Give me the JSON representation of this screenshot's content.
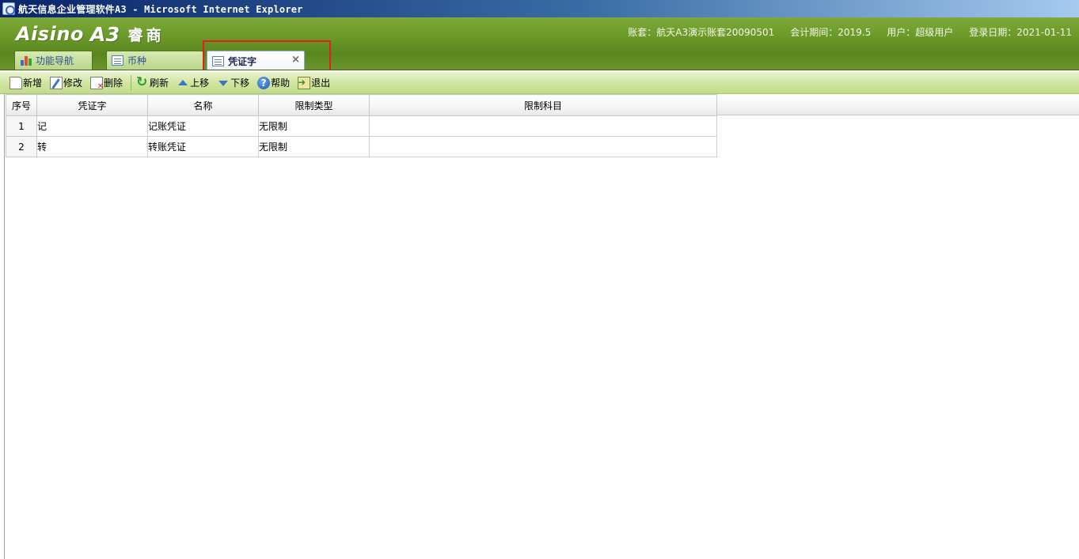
{
  "window": {
    "title": "航天信息企业管理软件A3 - Microsoft Internet Explorer"
  },
  "brand": {
    "logo_text": "Aisino",
    "logo_version": "A3",
    "product": "睿商"
  },
  "account_info": {
    "account": "账套：航天A3演示账套20090501",
    "period": "会计期间：2019.5",
    "user": "用户：超级用户",
    "login_date": "登录日期：2021-01-11"
  },
  "tabs": [
    {
      "label": "功能导航",
      "icon": "chart-icon",
      "active": false
    },
    {
      "label": "币种",
      "icon": "document-icon",
      "active": false
    },
    {
      "label": "凭证字",
      "icon": "document-icon",
      "active": true,
      "closable": true
    }
  ],
  "tab_close_glyph": "×",
  "toolbar": {
    "new": "新增",
    "edit": "修改",
    "delete": "删除",
    "refresh": "刷新",
    "move_up": "上移",
    "move_down": "下移",
    "help": "帮助",
    "exit": "退出"
  },
  "grid": {
    "columns": [
      "序号",
      "凭证字",
      "名称",
      "限制类型",
      "限制科目"
    ],
    "rows": [
      {
        "index": "1",
        "word": "记",
        "name": "记账凭证",
        "limit_type": "无限制",
        "limit_subject": ""
      },
      {
        "index": "2",
        "word": "转",
        "name": "转账凭证",
        "limit_type": "无限制",
        "limit_subject": ""
      }
    ]
  },
  "colors": {
    "header_green": "#6b9a2a",
    "toolbar_green": "#cfe59f",
    "highlight_red": "#e0201a",
    "title_blue": "#0a246a"
  }
}
